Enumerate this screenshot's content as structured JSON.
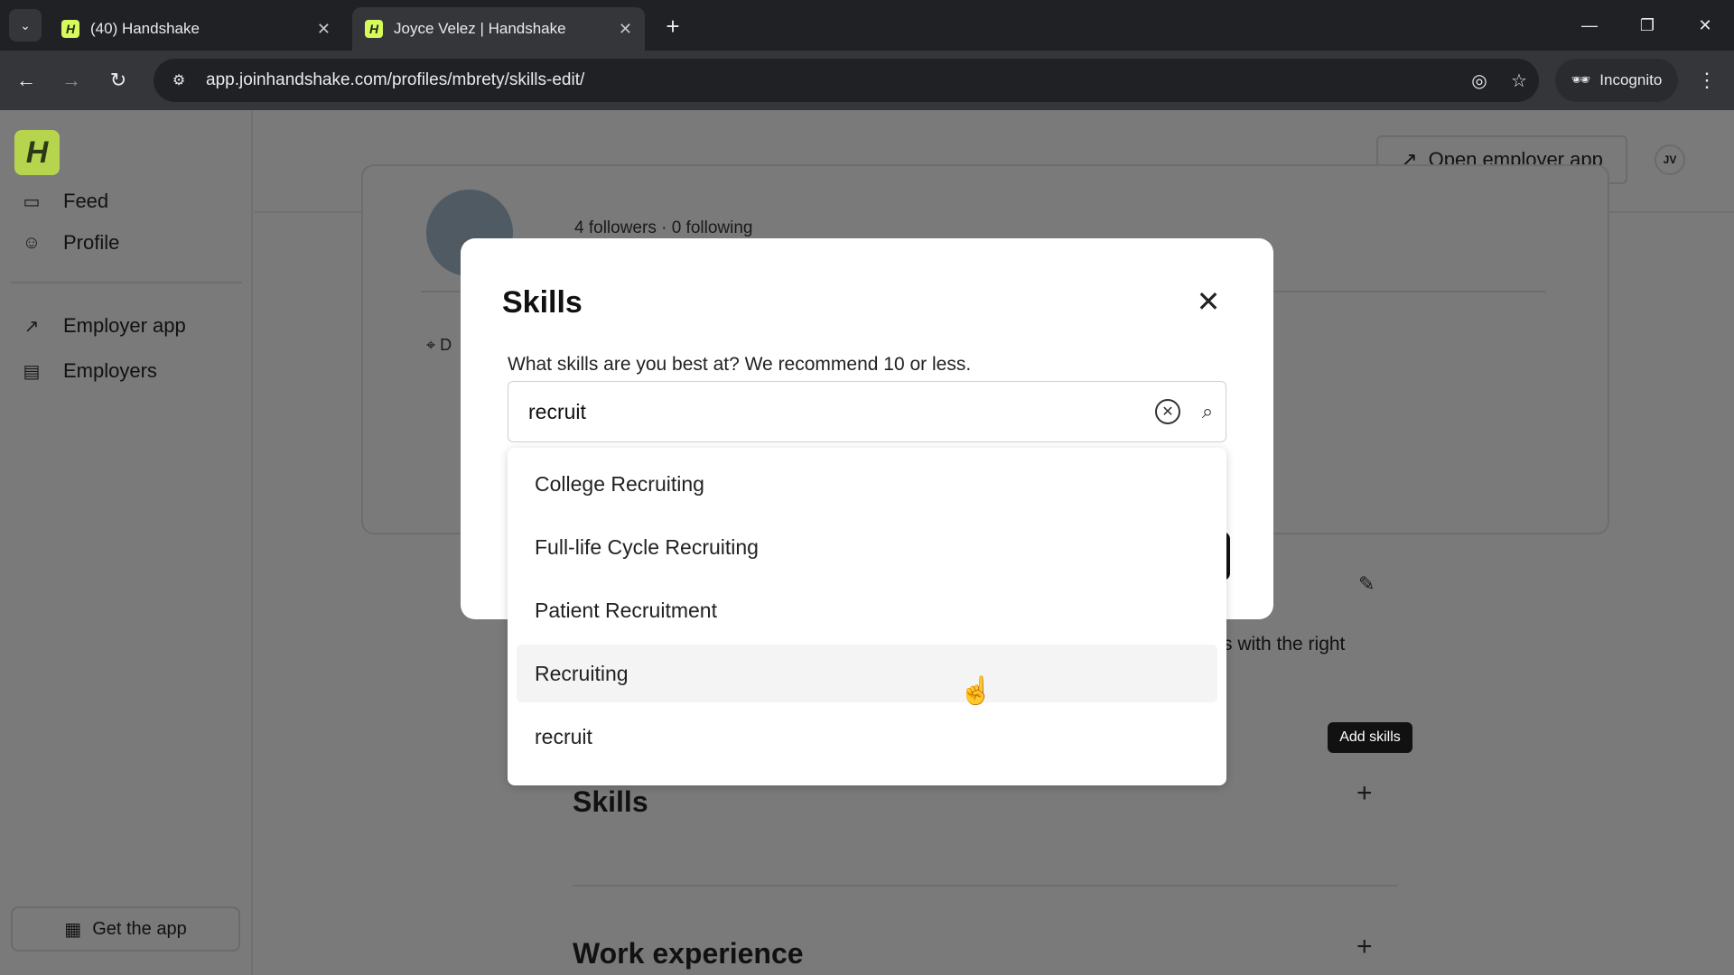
{
  "browser": {
    "tabs": [
      {
        "title": "(40) Handshake",
        "active": false
      },
      {
        "title": "Joyce Velez | Handshake",
        "active": true
      }
    ],
    "url": "app.joinhandshake.com/profiles/mbrety/skills-edit/",
    "incognito_label": "Incognito",
    "favicon_letter": "H"
  },
  "sidebar": {
    "logo_letter": "H",
    "items": [
      {
        "label": "Feed",
        "icon": "feed-icon"
      },
      {
        "label": "Profile",
        "icon": "person-icon"
      },
      {
        "label": "Employer app",
        "icon": "external-link-icon"
      },
      {
        "label": "Employers",
        "icon": "building-icon"
      }
    ],
    "get_app_label": "Get the app"
  },
  "header": {
    "open_employer_label": "Open employer app",
    "user_initials": "JV"
  },
  "profile": {
    "followers_text": "4 followers · 0 following",
    "location_initial": "D",
    "bg_text": "s with the right",
    "add_skills_tooltip": "Add skills",
    "sections": [
      {
        "title": "Skills"
      },
      {
        "title": "Work experience"
      }
    ]
  },
  "modal": {
    "title": "Skills",
    "description": "What skills are you best at? We recommend 10 or less.",
    "search_value": "recruit",
    "options": [
      "College Recruiting",
      "Full-life Cycle Recruiting",
      "Patient Recruitment",
      "Recruiting",
      "recruit"
    ]
  },
  "colors": {
    "accent": "#d6f95b",
    "overlay": "#7a7a7a",
    "modal_bg": "#ffffff"
  }
}
